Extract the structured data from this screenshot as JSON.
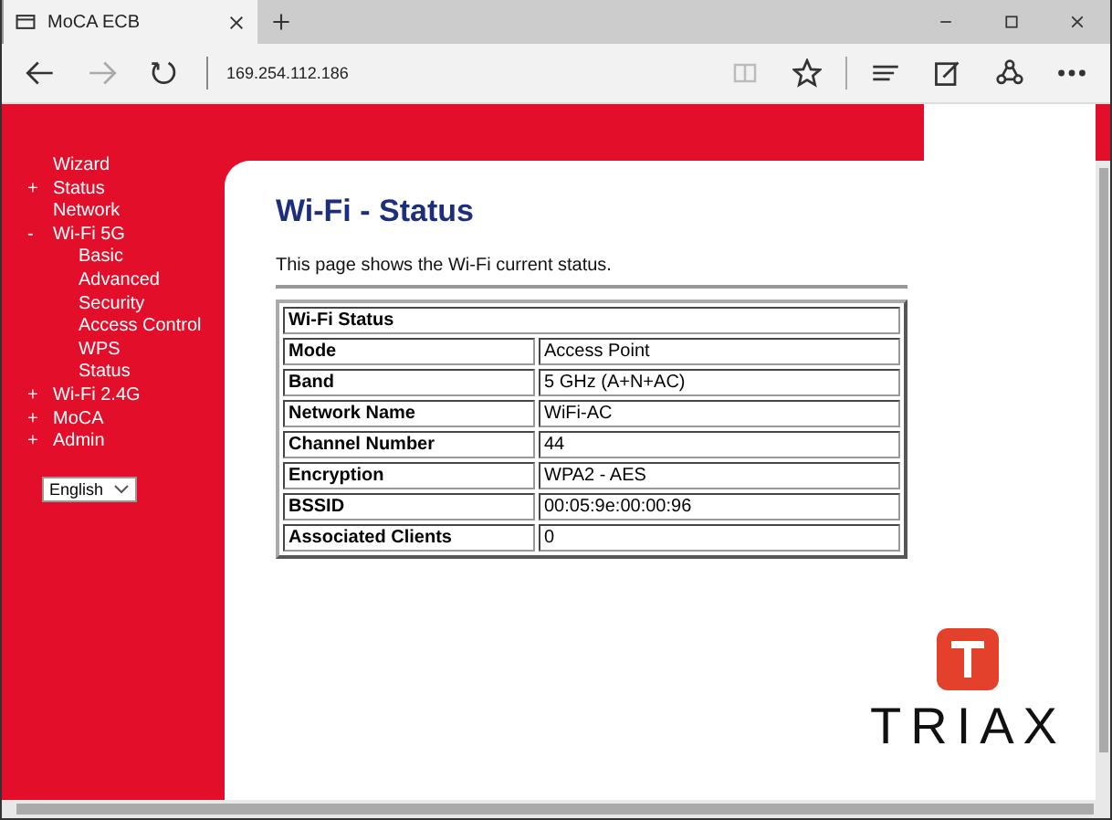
{
  "browser": {
    "tab_title": "MoCA ECB",
    "address": "169.254.112.186"
  },
  "sidebar": {
    "items": [
      {
        "label": "Wizard"
      },
      {
        "label": "Status",
        "marker": "+"
      },
      {
        "label": "Network"
      },
      {
        "label": "Wi-Fi 5G",
        "marker": "-",
        "children": [
          {
            "label": "Basic"
          },
          {
            "label": "Advanced"
          },
          {
            "label": "Security"
          },
          {
            "label": "Access Control"
          },
          {
            "label": "WPS"
          },
          {
            "label": "Status"
          }
        ]
      },
      {
        "label": "Wi-Fi 2.4G",
        "marker": "+"
      },
      {
        "label": "MoCA",
        "marker": "+"
      },
      {
        "label": "Admin",
        "marker": "+"
      }
    ],
    "language": "English"
  },
  "page": {
    "title": "Wi-Fi - Status",
    "description": "This page shows the Wi-Fi current status.",
    "table": {
      "heading": "Wi-Fi Status",
      "rows": [
        {
          "label": "Mode",
          "value": "Access Point"
        },
        {
          "label": "Band",
          "value": "5 GHz (A+N+AC)"
        },
        {
          "label": "Network Name",
          "value": "WiFi-AC"
        },
        {
          "label": "Channel Number",
          "value": "44"
        },
        {
          "label": "Encryption",
          "value": "WPA2 - AES"
        },
        {
          "label": "BSSID",
          "value": "00:05:9e:00:00:96"
        },
        {
          "label": "Associated Clients",
          "value": "0"
        }
      ]
    }
  },
  "logo": {
    "text": "TRIAX"
  }
}
